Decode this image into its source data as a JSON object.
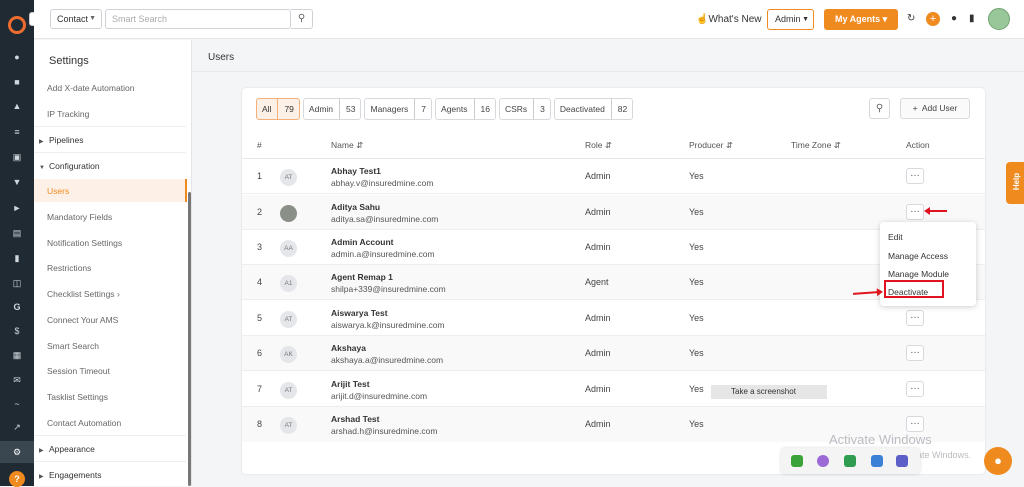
{
  "header": {
    "search_type": "Contact",
    "search_placeholder": "Smart Search",
    "whats_new": "What's New",
    "role_select": "Admin",
    "my_agents": "My Agents"
  },
  "sidebar": {
    "title": "Settings",
    "items": [
      {
        "label": "Add X-date Automation",
        "type": "item"
      },
      {
        "label": "IP Tracking",
        "type": "item"
      },
      {
        "label": "Pipelines",
        "type": "section"
      },
      {
        "label": "Configuration",
        "type": "section"
      },
      {
        "label": "Users",
        "type": "item",
        "active": true
      },
      {
        "label": "Mandatory Fields",
        "type": "item"
      },
      {
        "label": "Notification Settings",
        "type": "item"
      },
      {
        "label": "Restrictions",
        "type": "item"
      },
      {
        "label": "Checklist Settings",
        "type": "item"
      },
      {
        "label": "Connect Your AMS",
        "type": "item"
      },
      {
        "label": "Smart Search",
        "type": "item"
      },
      {
        "label": "Session Timeout",
        "type": "item"
      },
      {
        "label": "Tasklist Settings",
        "type": "item"
      },
      {
        "label": "Contact Automation",
        "type": "item"
      },
      {
        "label": "Appearance",
        "type": "section"
      },
      {
        "label": "Engagements",
        "type": "section"
      }
    ]
  },
  "page": {
    "title": "Users"
  },
  "tabs": [
    {
      "label": "All",
      "count": "79",
      "active": true
    },
    {
      "label": "Admin",
      "count": "53"
    },
    {
      "label": "Managers",
      "count": "7"
    },
    {
      "label": "Agents",
      "count": "16"
    },
    {
      "label": "CSRs",
      "count": "3"
    },
    {
      "label": "Deactivated",
      "count": "82"
    }
  ],
  "add_user": "Add User",
  "columns": {
    "num": "#",
    "name": "Name",
    "role": "Role",
    "producer": "Producer",
    "timezone": "Time Zone",
    "action": "Action"
  },
  "rows": [
    {
      "num": "1",
      "initials": "AT",
      "name": "Abhay Test1",
      "email": "abhay.v@insuredmine.com",
      "role": "Admin",
      "producer": "Yes"
    },
    {
      "num": "2",
      "initials": "",
      "name": "Aditya Sahu",
      "email": "aditya.sa@insuredmine.com",
      "role": "Admin",
      "producer": "Yes"
    },
    {
      "num": "3",
      "initials": "AA",
      "name": "Admin Account",
      "email": "admin.a@insuredmine.com",
      "role": "Admin",
      "producer": "Yes"
    },
    {
      "num": "4",
      "initials": "A1",
      "name": "Agent Remap 1",
      "email": "shilpa+339@insuredmine.com",
      "role": "Agent",
      "producer": "Yes"
    },
    {
      "num": "5",
      "initials": "AT",
      "name": "Aiswarya Test",
      "email": "aiswarya.k@insuredmine.com",
      "role": "Admin",
      "producer": "Yes"
    },
    {
      "num": "6",
      "initials": "AK",
      "name": "Akshaya",
      "email": "akshaya.a@insuredmine.com",
      "role": "Admin",
      "producer": "Yes"
    },
    {
      "num": "7",
      "initials": "AT",
      "name": "Arijit Test",
      "email": "arijit.d@insuredmine.com",
      "role": "Admin",
      "producer": "Yes"
    },
    {
      "num": "8",
      "initials": "AT",
      "name": "Arshad Test",
      "email": "arshad.h@insuredmine.com",
      "role": "Admin",
      "producer": "Yes"
    }
  ],
  "action_menu": [
    "Edit",
    "Manage Access",
    "Manage Module",
    "Deactivate"
  ],
  "tooltip": "Take a screenshot",
  "help_tab": "Help",
  "watermark": {
    "line1": "Activate Windows",
    "line2": "Go to Settings to activate Windows."
  }
}
